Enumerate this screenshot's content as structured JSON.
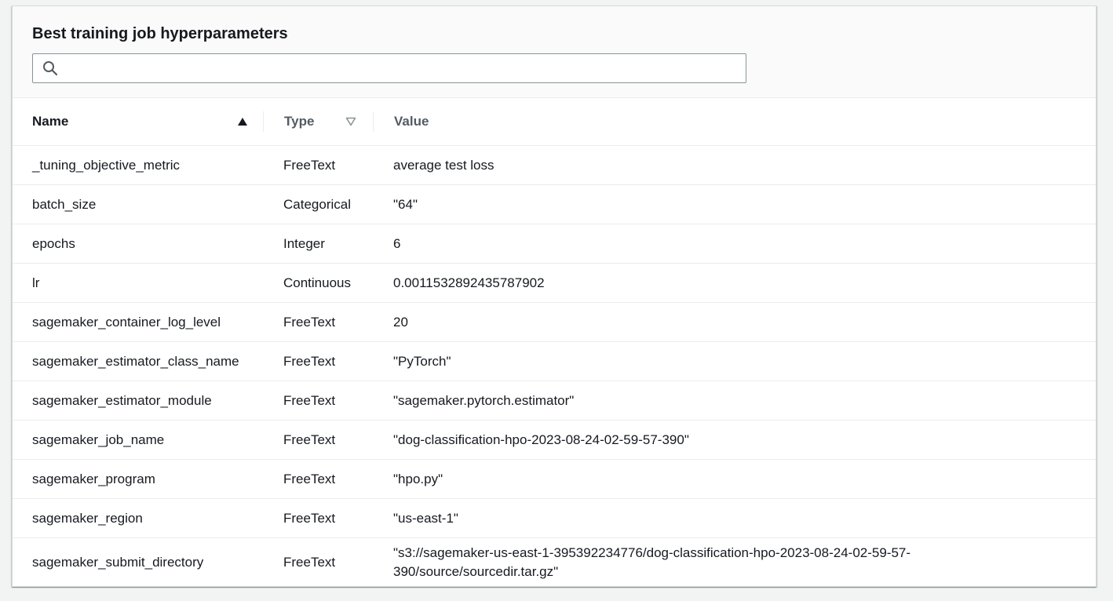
{
  "panel": {
    "title": "Best training job hyperparameters",
    "search": {
      "value": "",
      "placeholder": "",
      "icon": "search-icon"
    }
  },
  "table": {
    "columns": [
      {
        "label": "Name",
        "sort": "ascending",
        "icon": "sort-ascending-icon"
      },
      {
        "label": "Type",
        "sort": "unsorted",
        "icon": "sort-unsorted-icon"
      },
      {
        "label": "Value"
      }
    ],
    "rows": [
      {
        "name": "_tuning_objective_metric",
        "type": "FreeText",
        "value": "average test loss"
      },
      {
        "name": "batch_size",
        "type": "Categorical",
        "value": "\"64\""
      },
      {
        "name": "epochs",
        "type": "Integer",
        "value": "6"
      },
      {
        "name": "lr",
        "type": "Continuous",
        "value": "0.0011532892435787902"
      },
      {
        "name": "sagemaker_container_log_level",
        "type": "FreeText",
        "value": "20"
      },
      {
        "name": "sagemaker_estimator_class_name",
        "type": "FreeText",
        "value": "\"PyTorch\""
      },
      {
        "name": "sagemaker_estimator_module",
        "type": "FreeText",
        "value": "\"sagemaker.pytorch.estimator\""
      },
      {
        "name": "sagemaker_job_name",
        "type": "FreeText",
        "value": "\"dog-classification-hpo-2023-08-24-02-59-57-390\""
      },
      {
        "name": "sagemaker_program",
        "type": "FreeText",
        "value": "\"hpo.py\""
      },
      {
        "name": "sagemaker_region",
        "type": "FreeText",
        "value": "\"us-east-1\""
      },
      {
        "name": "sagemaker_submit_directory",
        "type": "FreeText",
        "value": "\"s3://sagemaker-us-east-1-395392234776/dog-classification-hpo-2023-08-24-02-59-57-390/source/sourcedir.tar.gz\""
      }
    ]
  }
}
